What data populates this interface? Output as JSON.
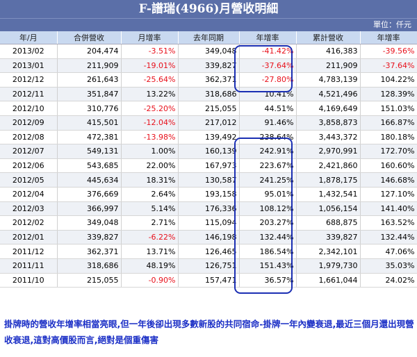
{
  "title": "F-譜瑞(4966)月營收明細",
  "unit": "單位：仟元",
  "columns": [
    "年/月",
    "合併營收",
    "月增率",
    "去年同期",
    "年增率",
    "累計營收",
    "年增率"
  ],
  "rows": [
    [
      "2013/02",
      "204,474",
      "-3.51%",
      "349,048",
      "-41.42%",
      "416,383",
      "-39.56%"
    ],
    [
      "2013/01",
      "211,909",
      "-19.01%",
      "339,827",
      "-37.64%",
      "211,909",
      "-37.64%"
    ],
    [
      "2012/12",
      "261,643",
      "-25.64%",
      "362,371",
      "-27.80%",
      "4,783,139",
      "104.22%"
    ],
    [
      "2012/11",
      "351,847",
      "13.22%",
      "318,686",
      "10.41%",
      "4,521,496",
      "128.39%"
    ],
    [
      "2012/10",
      "310,776",
      "-25.20%",
      "215,055",
      "44.51%",
      "4,169,649",
      "151.03%"
    ],
    [
      "2012/09",
      "415,501",
      "-12.04%",
      "217,012",
      "91.46%",
      "3,858,873",
      "166.87%"
    ],
    [
      "2012/08",
      "472,381",
      "-13.98%",
      "139,492",
      "238.64%",
      "3,443,372",
      "180.18%"
    ],
    [
      "2012/07",
      "549,131",
      "1.00%",
      "160,139",
      "242.91%",
      "2,970,991",
      "172.70%"
    ],
    [
      "2012/06",
      "543,685",
      "22.00%",
      "167,973",
      "223.67%",
      "2,421,860",
      "160.60%"
    ],
    [
      "2012/05",
      "445,634",
      "18.31%",
      "130,587",
      "241.25%",
      "1,878,175",
      "146.68%"
    ],
    [
      "2012/04",
      "376,669",
      "2.64%",
      "193,158",
      "95.01%",
      "1,432,541",
      "127.10%"
    ],
    [
      "2012/03",
      "366,997",
      "5.14%",
      "176,336",
      "108.12%",
      "1,056,154",
      "141.40%"
    ],
    [
      "2012/02",
      "349,048",
      "2.71%",
      "115,094",
      "203.27%",
      "688,875",
      "163.52%"
    ],
    [
      "2012/01",
      "339,827",
      "-6.22%",
      "146,198",
      "132.44%",
      "339,827",
      "132.44%"
    ],
    [
      "2011/12",
      "362,371",
      "13.71%",
      "126,465",
      "186.54%",
      "2,342,101",
      "47.06%"
    ],
    [
      "2011/11",
      "318,686",
      "48.19%",
      "126,751",
      "151.43%",
      "1,979,730",
      "35.03%"
    ],
    [
      "2011/10",
      "215,055",
      "-0.90%",
      "157,471",
      "36.57%",
      "1,661,044",
      "24.02%"
    ]
  ],
  "note": "掛牌時的營收年增率相當亮眼,但一年後卻出現多數新股的共同宿命-掛牌一年內變衰退,最近三個月還出現營收衰退,這對高價股而言,絕對是個重傷害",
  "colors": {
    "header": "#5b6fa8",
    "negative": "#e8101b",
    "annotation": "#1b2fb3"
  }
}
